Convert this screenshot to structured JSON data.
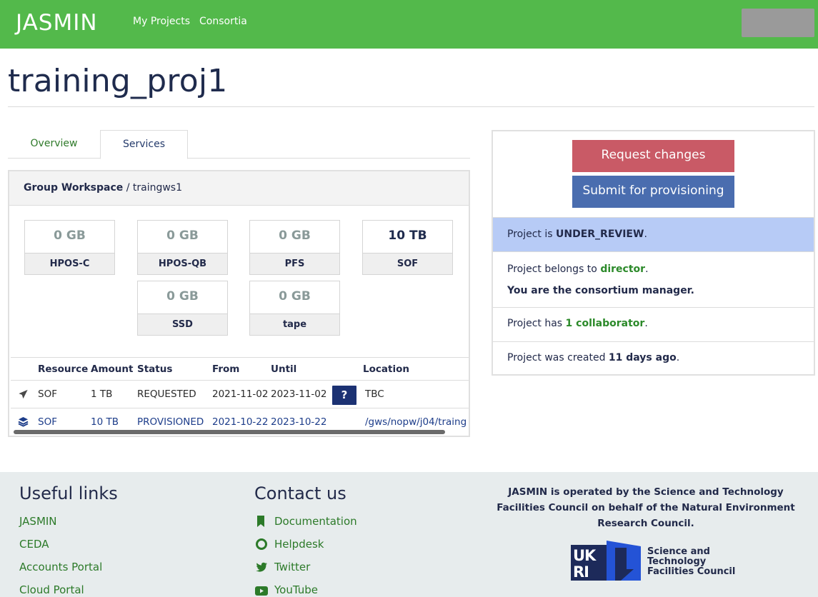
{
  "header": {
    "brand": "JASMIN",
    "nav": [
      "My Projects",
      "Consortia"
    ]
  },
  "project": {
    "title": "training_proj1"
  },
  "tabs": [
    "Overview",
    "Services"
  ],
  "service": {
    "type": "Group Workspace",
    "separator": " / ",
    "name": "traingws1"
  },
  "quotas": [
    {
      "value": "0 GB",
      "label": "HPOS-C"
    },
    {
      "value": "0 GB",
      "label": "HPOS-QB"
    },
    {
      "value": "0 GB",
      "label": "PFS"
    },
    {
      "value": "10 TB",
      "label": "SOF"
    },
    {
      "value": "0 GB",
      "label": "SSD"
    },
    {
      "value": "0 GB",
      "label": "tape"
    }
  ],
  "table": {
    "headers": [
      "Resource",
      "Amount",
      "Status",
      "From",
      "Until",
      "Location"
    ],
    "rows": [
      {
        "icon": "paper-plane-icon",
        "resource": "SOF",
        "amount": "1 TB",
        "status": "REQUESTED",
        "from": "2021-11-02",
        "until": "2023-11-02",
        "help": "?",
        "location": "TBC"
      },
      {
        "icon": "layers-icon",
        "resource": "SOF",
        "amount": "10 TB",
        "status": "PROVISIONED",
        "from": "2021-10-22",
        "until": "2023-10-22",
        "location": "/gws/nopw/j04/traing"
      }
    ]
  },
  "side": {
    "request_changes": "Request changes",
    "submit": "Submit for provisioning",
    "status_prefix": "Project is ",
    "status": "UNDER_REVIEW",
    "owner_prefix": "Project belongs to ",
    "owner": "director",
    "manager_note": "You are the consortium manager.",
    "collab_prefix": "Project has ",
    "collab": "1 collaborator",
    "created_prefix": "Project was created ",
    "created": "11 days ago"
  },
  "footer": {
    "useful_title": "Useful links",
    "useful_links": [
      "JASMIN",
      "CEDA",
      "Accounts Portal",
      "Cloud Portal"
    ],
    "contact_title": "Contact us",
    "contact_links": [
      "Documentation",
      "Helpdesk",
      "Twitter",
      "YouTube"
    ],
    "org_text": "JASMIN is operated by the Science and Technology Facilities Council on behalf of the Natural Environment Research Council.",
    "ukri_lines": [
      "Science and",
      "Technology",
      "Facilities Council"
    ],
    "logo_text": "UKRI"
  },
  "colors": {
    "brand_green": "#53b94b",
    "request_red": "#c95a66",
    "submit_blue": "#4a6daf",
    "status_bg": "#b7cbf6"
  }
}
